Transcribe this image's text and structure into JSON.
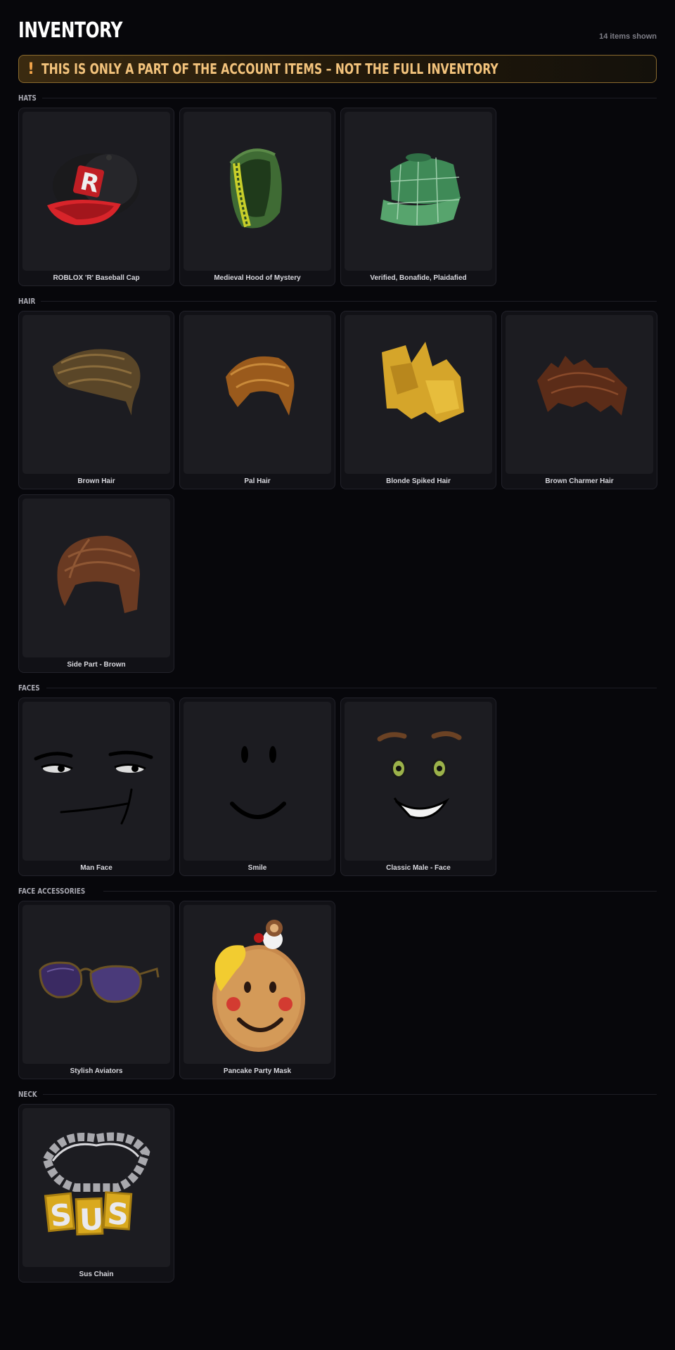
{
  "header": {
    "title": "INVENTORY",
    "count": "14 items shown"
  },
  "banner": {
    "icon": "!",
    "icon_name": "warning-icon",
    "text": "THIS IS ONLY A PART OF THE ACCOUNT ITEMS – NOT THE FULL INVENTORY",
    "accent": "#f3c37c"
  },
  "sections": [
    {
      "label": "HATS",
      "items": [
        {
          "name": "ROBLOX 'R' Baseball Cap",
          "icon": "roblox-r-baseball-cap-icon"
        },
        {
          "name": "Medieval Hood of Mystery",
          "icon": "medieval-hood-icon"
        },
        {
          "name": "Verified, Bonafide, Plaidafied",
          "icon": "plaid-cap-icon"
        }
      ]
    },
    {
      "label": "HAIR",
      "items": [
        {
          "name": "Brown Hair",
          "icon": "brown-hair-icon"
        },
        {
          "name": "Pal Hair",
          "icon": "pal-hair-icon"
        },
        {
          "name": "Blonde Spiked Hair",
          "icon": "blonde-spiked-hair-icon"
        },
        {
          "name": "Brown Charmer Hair",
          "icon": "brown-charmer-hair-icon"
        },
        {
          "name": "Side Part - Brown",
          "icon": "side-part-hair-icon"
        }
      ]
    },
    {
      "label": "FACES",
      "items": [
        {
          "name": "Man Face",
          "icon": "man-face-icon"
        },
        {
          "name": "Smile",
          "icon": "smile-face-icon"
        },
        {
          "name": "Classic Male - Face",
          "icon": "classic-male-face-icon"
        }
      ]
    },
    {
      "label": "FACE ACCESSORIES",
      "items": [
        {
          "name": "Stylish Aviators",
          "icon": "aviator-sunglasses-icon"
        },
        {
          "name": "Pancake Party Mask",
          "icon": "pancake-mask-icon"
        }
      ]
    },
    {
      "label": "NECK",
      "items": [
        {
          "name": "Sus Chain",
          "icon": "sus-chain-icon"
        }
      ]
    }
  ]
}
